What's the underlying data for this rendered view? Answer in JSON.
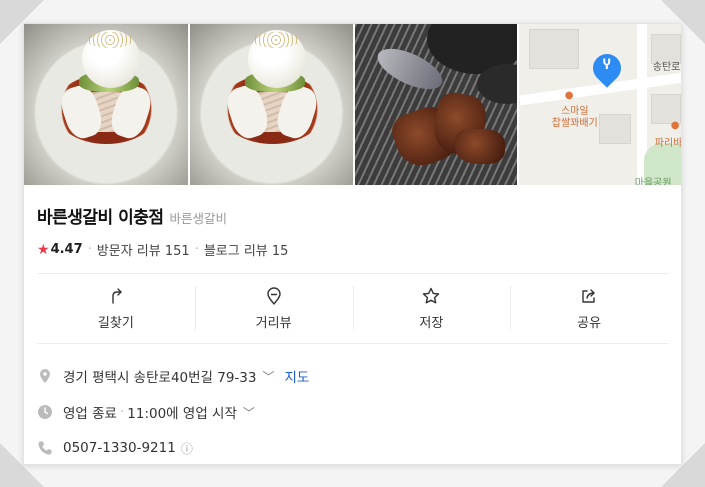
{
  "place": {
    "name": "바른생갈비 이충점",
    "category": "바른생갈비",
    "rating": "4.47",
    "visitor_reviews": "방문자 리뷰 151",
    "blog_reviews": "블로그 리뷰 15"
  },
  "map": {
    "street_label": "송탄로",
    "poi_label": "스마일\n찹쌀꽈배기",
    "poi_label_2": "파리바",
    "park_label": "마을공원"
  },
  "actions": [
    {
      "label": "길찾기",
      "icon": "directions-icon"
    },
    {
      "label": "거리뷰",
      "icon": "street-view-icon"
    },
    {
      "label": "저장",
      "icon": "star-outline-icon"
    },
    {
      "label": "공유",
      "icon": "share-icon"
    }
  ],
  "details": {
    "address": "경기 평택시 송탄로40번길 79-33",
    "map_link": "지도",
    "hours_status": "영업 종료",
    "hours_next": "11:00에 영업 시작",
    "phone": "0507-1330-9211"
  },
  "colors": {
    "rating_star": "#f2364a",
    "link": "#1a5fcc",
    "map_pin": "#2c8cf4"
  }
}
